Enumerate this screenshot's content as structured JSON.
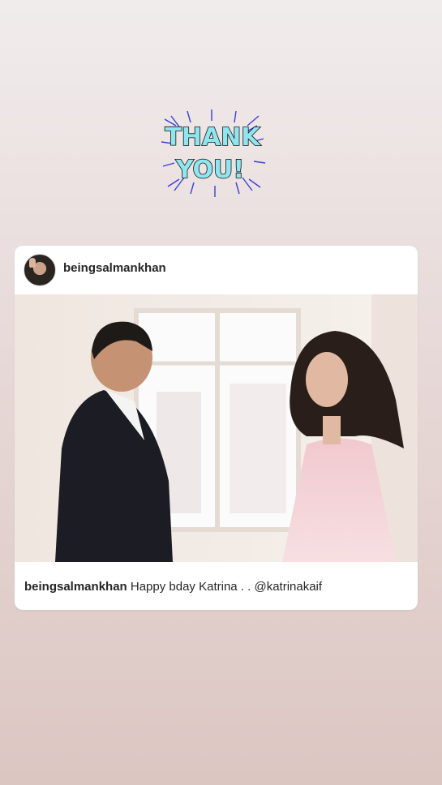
{
  "sticker": {
    "line1": "THANK",
    "line2": "YOU!",
    "icon": "thank-you-sticker"
  },
  "post": {
    "username": "beingsalmankhan",
    "avatar_icon": "profile-avatar",
    "image_icon": "post-photo",
    "caption_username": "beingsalmankhan",
    "caption_text": "Happy bday Katrina . . @katrinakaif"
  },
  "colors": {
    "background_top": "#f1ecec",
    "background_bottom": "#dcc6c2",
    "card": "#ffffff",
    "text": "#262626",
    "sticker_fill": "#8fe6ef",
    "sticker_burst": "#3b3fd8"
  }
}
